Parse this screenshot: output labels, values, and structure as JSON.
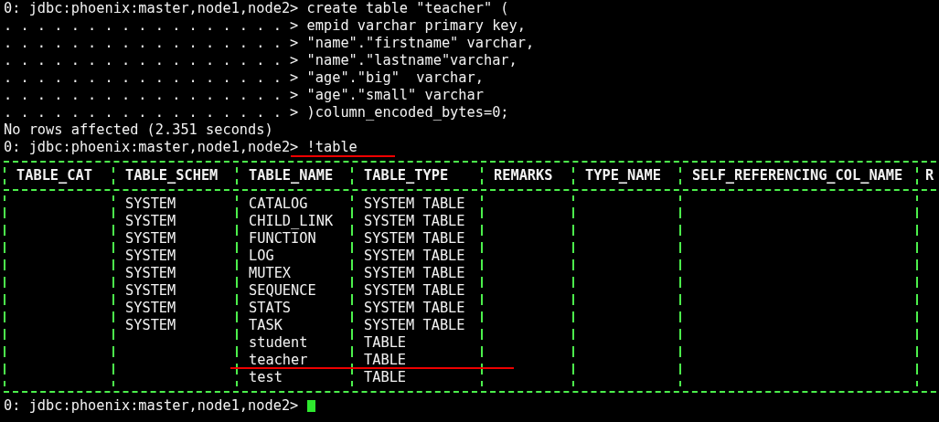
{
  "terminal": {
    "lines": [
      {
        "kind": "prompt",
        "prompt": "0: jdbc:phoenix:master,node1,node2> ",
        "command": "create table \"teacher\" ("
      },
      {
        "kind": "continuation",
        "prompt": ". . . . . . . . . . . . . . . . . > ",
        "command": "empid varchar primary key,"
      },
      {
        "kind": "continuation",
        "prompt": ". . . . . . . . . . . . . . . . . > ",
        "command": "\"name\".\"firstname\" varchar,"
      },
      {
        "kind": "continuation",
        "prompt": ". . . . . . . . . . . . . . . . . > ",
        "command": "\"name\".\"lastname\"varchar,"
      },
      {
        "kind": "continuation",
        "prompt": ". . . . . . . . . . . . . . . . . > ",
        "command": "\"age\".\"big\"  varchar,"
      },
      {
        "kind": "continuation",
        "prompt": ". . . . . . . . . . . . . . . . . > ",
        "command": "\"age\".\"small\" varchar"
      },
      {
        "kind": "continuation",
        "prompt": ". . . . . . . . . . . . . . . . . > ",
        "command": ")column_encoded_bytes=0;"
      },
      {
        "kind": "output",
        "text": "No rows affected (2.351 seconds)"
      },
      {
        "kind": "prompt",
        "prompt": "0: jdbc:phoenix:master,node1,node2> ",
        "command": "!table"
      }
    ],
    "table": {
      "columns": [
        "TABLE_CAT",
        "TABLE_SCHEM",
        "TABLE_NAME",
        "TABLE_TYPE",
        "REMARKS",
        "TYPE_NAME",
        "SELF_REFERENCING_COL_NAME",
        "R"
      ],
      "rows": [
        {
          "table_schem": "SYSTEM",
          "table_name": "CATALOG",
          "table_type": "SYSTEM TABLE"
        },
        {
          "table_schem": "SYSTEM",
          "table_name": "CHILD_LINK",
          "table_type": "SYSTEM TABLE"
        },
        {
          "table_schem": "SYSTEM",
          "table_name": "FUNCTION",
          "table_type": "SYSTEM TABLE"
        },
        {
          "table_schem": "SYSTEM",
          "table_name": "LOG",
          "table_type": "SYSTEM TABLE"
        },
        {
          "table_schem": "SYSTEM",
          "table_name": "MUTEX",
          "table_type": "SYSTEM TABLE"
        },
        {
          "table_schem": "SYSTEM",
          "table_name": "SEQUENCE",
          "table_type": "SYSTEM TABLE"
        },
        {
          "table_schem": "SYSTEM",
          "table_name": "STATS",
          "table_type": "SYSTEM TABLE"
        },
        {
          "table_schem": "SYSTEM",
          "table_name": "TASK",
          "table_type": "SYSTEM TABLE"
        },
        {
          "table_name": "student",
          "table_type": "TABLE"
        },
        {
          "table_name": "teacher",
          "table_type": "TABLE"
        },
        {
          "table_name": "test",
          "table_type": "TABLE"
        }
      ]
    },
    "last_prompt": "0: jdbc:phoenix:master,node1,node2> "
  }
}
